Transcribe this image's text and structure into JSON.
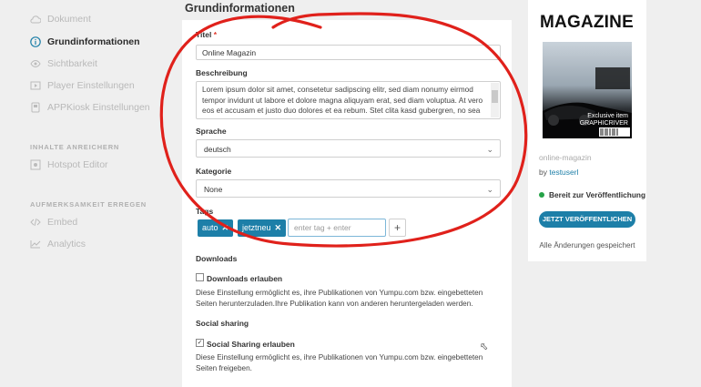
{
  "sidebar": {
    "items": [
      {
        "label": "Dokument",
        "icon": "cloud-icon"
      },
      {
        "label": "Grundinformationen",
        "icon": "info-icon"
      },
      {
        "label": "Sichtbarkeit",
        "icon": "eye-icon"
      },
      {
        "label": "Player Einstellungen",
        "icon": "player-icon"
      },
      {
        "label": "APPKiosk Einstellungen",
        "icon": "app-icon"
      }
    ],
    "section1": "INHALTE ANREICHERN",
    "section1_items": [
      {
        "label": "Hotspot Editor",
        "icon": "hotspot-icon"
      }
    ],
    "section2": "AUFMERKSAMKEIT ERREGEN",
    "section2_items": [
      {
        "label": "Embed",
        "icon": "code-icon"
      },
      {
        "label": "Analytics",
        "icon": "chart-icon"
      }
    ]
  },
  "main": {
    "title": "Grundinformationen",
    "titel_label": "Titel",
    "titel_required": "*",
    "titel_value": "Online Magazin",
    "beschreibung_label": "Beschreibung",
    "beschreibung_value": "Lorem ipsum dolor sit amet, consetetur sadipscing elitr, sed diam nonumy eirmod tempor invidunt ut labore et dolore magna aliquyam erat, sed diam voluptua. At vero eos et accusam et justo duo dolores et ea rebum. Stet clita kasd gubergren, no sea",
    "sprache_label": "Sprache",
    "sprache_value": "deutsch",
    "kategorie_label": "Kategorie",
    "kategorie_value": "None",
    "tags_label": "Tags",
    "tags": [
      "auto",
      "jetztneu"
    ],
    "tag_placeholder": "enter tag + enter",
    "add_symbol": "+",
    "downloads_heading": "Downloads",
    "downloads_checkbox": "Downloads erlauben",
    "downloads_desc": "Diese Einstellung ermöglicht es, ihre Publikationen von Yumpu.com bzw. eingebetteten Seiten herunterzuladen.Ihre Publikation kann von anderen heruntergeladen werden.",
    "social_heading": "Social sharing",
    "social_checkbox": "Social Sharing erlauben",
    "social_desc": "Diese Einstellung ermöglicht es, ihre Publikationen von Yumpu.com bzw. eingebetteten Seiten freigeben."
  },
  "right": {
    "cover_title": "MAGAZINE",
    "cover_text": "Exclusive item GRAPHICRIVER",
    "pub_name": "online-magazin",
    "by_label": "by",
    "author": "testuserl",
    "status": "Bereit zur Veröffentlichung",
    "publish_button": "JETZT VERÖFFENTLICHEN",
    "saved_text": "Alle Änderungen gespeichert"
  },
  "colors": {
    "accent": "#1d7fa8",
    "annotation": "#e0211b",
    "ready": "#25a247"
  }
}
